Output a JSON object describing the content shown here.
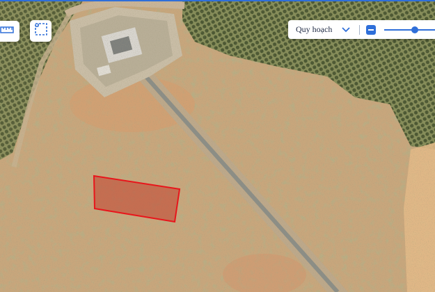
{
  "map": {
    "basemap": "satellite",
    "highlighted_parcel": {
      "outline_color": "#e8151b",
      "fill_color": "#c2402d"
    }
  },
  "toolbar": {
    "ruler_icon": "ruler-icon",
    "select_area_icon": "select-area-icon"
  },
  "layer_panel": {
    "selected_layer": "Quy hoạch",
    "dropdown_icon": "chevron-down-icon",
    "zoom_out_icon": "minus-icon",
    "opacity_level": 0.55,
    "accent_color": "#2f6fd9"
  }
}
